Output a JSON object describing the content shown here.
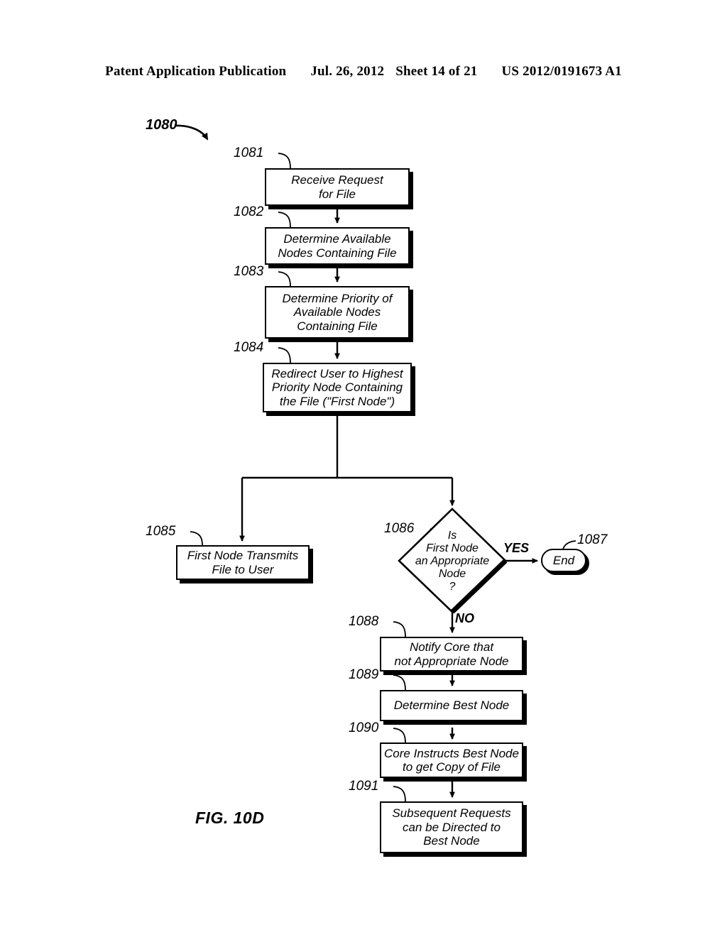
{
  "header": {
    "publication": "Patent Application Publication",
    "date": "Jul. 26, 2012",
    "sheet": "Sheet 14 of 21",
    "patent_number": "US 2012/0191673 A1"
  },
  "figure": {
    "caption": "FIG. 10D",
    "flow_ref": "1080",
    "nodes": [
      {
        "id": "1081",
        "ref": "1081",
        "type": "process",
        "text": "Receive Request\nfor File"
      },
      {
        "id": "1082",
        "ref": "1082",
        "type": "process",
        "text": "Determine Available\nNodes Containing File"
      },
      {
        "id": "1083",
        "ref": "1083",
        "type": "process",
        "text": "Determine Priority of\nAvailable Nodes\nContaining File"
      },
      {
        "id": "1084",
        "ref": "1084",
        "type": "process",
        "text": "Redirect User to Highest\nPriority Node Containing\nthe File (\"First Node\")"
      },
      {
        "id": "1085",
        "ref": "1085",
        "type": "process",
        "text": "First Node Transmits\nFile to User"
      },
      {
        "id": "1086",
        "ref": "1086",
        "type": "decision",
        "text": "Is\nFirst Node\nan Appropriate\nNode\n?"
      },
      {
        "id": "1087",
        "ref": "1087",
        "type": "terminator",
        "text": "End"
      },
      {
        "id": "1088",
        "ref": "1088",
        "type": "process",
        "text": "Notify Core that\nnot Appropriate Node"
      },
      {
        "id": "1089",
        "ref": "1089",
        "type": "process",
        "text": "Determine Best Node"
      },
      {
        "id": "1090",
        "ref": "1090",
        "type": "process",
        "text": "Core Instructs Best Node\nto get Copy of File"
      },
      {
        "id": "1091",
        "ref": "1091",
        "type": "process",
        "text": "Subsequent Requests\ncan be Directed to\nBest Node"
      }
    ],
    "branch_labels": {
      "yes": "YES",
      "no": "NO"
    }
  }
}
